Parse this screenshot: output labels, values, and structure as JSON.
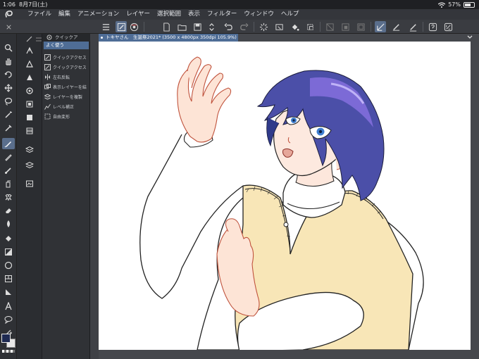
{
  "status": {
    "time": "1:06",
    "date": "8月7日(土)",
    "battery": "57%",
    "battery_level": 0.57
  },
  "menu": [
    "ファイル",
    "編集",
    "アニメーション",
    "レイヤー",
    "選択範囲",
    "表示",
    "フィルター",
    "ウィンドウ",
    "ヘルプ"
  ],
  "quick_access": {
    "tab_label": "クイックア",
    "selected": "よく使う",
    "items": [
      "クイックアクセス",
      "クイックアクセス",
      "左右反転",
      "表示レイヤーを結",
      "レイヤーを複製",
      "レベル補正",
      "自由変形"
    ]
  },
  "document": {
    "tab_label": "トキヤさん　生誕祭2021* (3500 x 4800px 350dpi 105.9%)"
  },
  "colors": {
    "main": "#1e2a52",
    "sub": "#e8e8e8",
    "accent": "#4f6d96"
  },
  "icons": {
    "toolbar": [
      "menu-icon",
      "pen-setting-icon",
      "eye-icon",
      "new-file-icon",
      "open-folder-icon",
      "save-icon",
      "arrows-icon",
      "undo-icon",
      "redo-icon",
      "spinner-icon",
      "clear-icon",
      "fill-icon",
      "transform-icon",
      "invert-icon",
      "select-all-icon",
      "deselect-icon",
      "crop-icon",
      "ruler-icon",
      "brush-icon",
      "pen-icon",
      "help-icon",
      "settings-icon"
    ],
    "tools": [
      "zoom-icon",
      "hand-icon",
      "rotate-icon",
      "move-icon",
      "lasso-icon",
      "magic-wand-icon",
      "eyedropper-icon",
      "pen-tool-icon",
      "pencil-icon",
      "brush-tool-icon",
      "airbrush-icon",
      "decoration-icon",
      "eraser-icon",
      "blend-icon",
      "fill-tool-icon",
      "gradient-icon",
      "shape-icon",
      "frame-icon",
      "ruler-tool-icon",
      "text-icon",
      "balloon-icon",
      "line-correction-icon"
    ]
  }
}
